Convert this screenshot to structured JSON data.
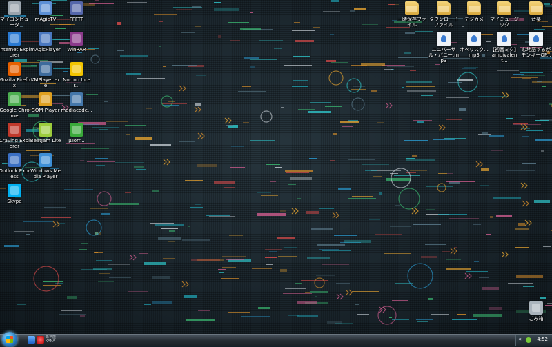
{
  "desktop": {
    "icons_left": [
      {
        "label": "マイコンピュータ",
        "icon": "computer-icon",
        "color": "#9aa4ad"
      },
      {
        "label": "Internet Explorer",
        "icon": "internet-explorer-icon",
        "color": "#2a7ad2"
      },
      {
        "label": "Mozilla Firefox",
        "icon": "firefox-icon",
        "color": "#e66000"
      },
      {
        "label": "Google Chrome",
        "icon": "chrome-icon",
        "color": "#4caf50"
      },
      {
        "label": "Craving Explorer",
        "icon": "craving-explorer-icon",
        "color": "#c0392b"
      },
      {
        "label": "Outlook Express",
        "icon": "outlook-express-icon",
        "color": "#3a6fc4"
      },
      {
        "label": "Skype",
        "icon": "skype-icon",
        "color": "#00aff0"
      },
      {
        "label": "mAgicTV",
        "icon": "magictv-icon",
        "color": "#5c8fd6"
      },
      {
        "label": "mAgicPlayer",
        "icon": "magicplayer-icon",
        "color": "#4a78c0"
      },
      {
        "label": "KMPlayer.exe",
        "icon": "kmplayer-icon",
        "color": "#3d6b9c"
      },
      {
        "label": "GOM Player",
        "icon": "gom-player-icon",
        "color": "#e0a020"
      },
      {
        "label": "BeatJam Lite",
        "icon": "beatjam-icon",
        "color": "#9ccc3c"
      },
      {
        "label": "Windows Media Player",
        "icon": "windows-media-player-icon",
        "color": "#3d8fd6"
      },
      {
        "label": "FFFTP",
        "icon": "ffftp-icon",
        "color": "#5566aa"
      },
      {
        "label": "WinRAR",
        "icon": "winrar-icon",
        "color": "#8b3a8b"
      },
      {
        "label": "Norton Inter...",
        "icon": "norton-icon",
        "color": "#f2c400"
      },
      {
        "label": "mediacode...",
        "icon": "mediacoder-icon",
        "color": "#4477aa"
      },
      {
        "label": "µTorr...",
        "icon": "utorrent-icon",
        "color": "#3aaa3a"
      }
    ],
    "icons_right": [
      {
        "label": "一時保存ファイル",
        "icon": "folder-icon",
        "color": "#e8c35a"
      },
      {
        "label": "ダウンロードファイル",
        "icon": "folder-icon",
        "color": "#e8c35a"
      },
      {
        "label": "デジカメ",
        "icon": "folder-icon",
        "color": "#e8c35a"
      },
      {
        "label": "マイミュージック",
        "icon": "folder-icon",
        "color": "#e8c35a"
      },
      {
        "label": "音楽",
        "icon": "folder-icon",
        "color": "#e8c35a"
      },
      {
        "label": "ユニバーサル・バニー.mp3",
        "icon": "audio-file-icon",
        "color": "#eef2f6"
      },
      {
        "label": "オベリスク...mp3",
        "icon": "audio-file-icon",
        "color": "#eef2f6"
      },
      {
        "label": "【初音ミク】ambivalent...",
        "icon": "audio-file-icon",
        "color": "#eef2f6"
      },
      {
        "label": "む地語するがモンキーOP...",
        "icon": "audio-file-icon",
        "color": "#eef2f6"
      },
      {
        "label": "ごみ箱",
        "icon": "recycle-bin-icon",
        "color": "#aab4bc"
      }
    ]
  },
  "taskbar": {
    "lang_line1": "あア般",
    "lang_line2": "KANA",
    "tray_arrow": "«",
    "clock": "4:52"
  }
}
